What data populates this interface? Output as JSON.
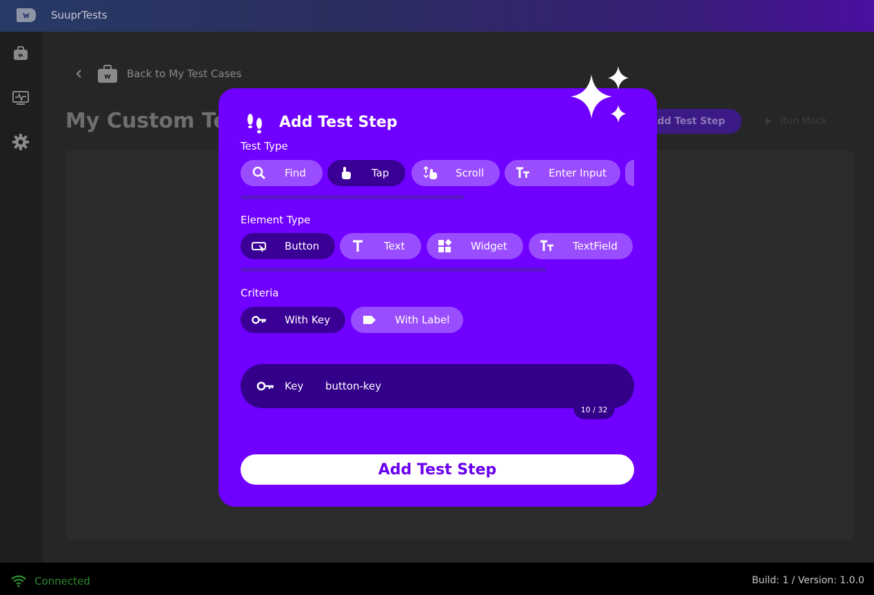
{
  "app": {
    "title": "SuuprTests"
  },
  "header": {
    "back_label": "Back to My Test Cases",
    "page_title": "My Custom Test",
    "add_step_label": "Add Test Step",
    "run_label": "Run Mock"
  },
  "modal": {
    "title": "Add Test Step",
    "test_type": {
      "label": "Test Type",
      "options": [
        {
          "label": "Find",
          "icon": "search-icon",
          "selected": false
        },
        {
          "label": "Tap",
          "icon": "tap-icon",
          "selected": true
        },
        {
          "label": "Scroll",
          "icon": "scroll-icon",
          "selected": false
        },
        {
          "label": "Enter Input",
          "icon": "text-size-icon",
          "selected": false
        }
      ]
    },
    "element_type": {
      "label": "Element Type",
      "options": [
        {
          "label": "Button",
          "icon": "button-icon",
          "selected": true
        },
        {
          "label": "Text",
          "icon": "text-icon",
          "selected": false
        },
        {
          "label": "Widget",
          "icon": "widgets-icon",
          "selected": false
        },
        {
          "label": "TextField",
          "icon": "text-size-icon",
          "selected": false
        }
      ]
    },
    "criteria": {
      "label": "Criteria",
      "options": [
        {
          "label": "With Key",
          "icon": "key-icon",
          "selected": true
        },
        {
          "label": "With Label",
          "icon": "label-icon",
          "selected": false
        }
      ]
    },
    "key_field": {
      "label": "Key",
      "value": "button-key",
      "counter": "10 / 32"
    },
    "submit_label": "Add Test Step"
  },
  "footer": {
    "status": "Connected",
    "build": "Build: 1 / Version: 1.0.0"
  },
  "colors": {
    "modal_bg": "#7000ff",
    "chip_bg": "#9a4dff",
    "chip_selected": "#3a0096",
    "status_green": "#2e8b2e"
  }
}
